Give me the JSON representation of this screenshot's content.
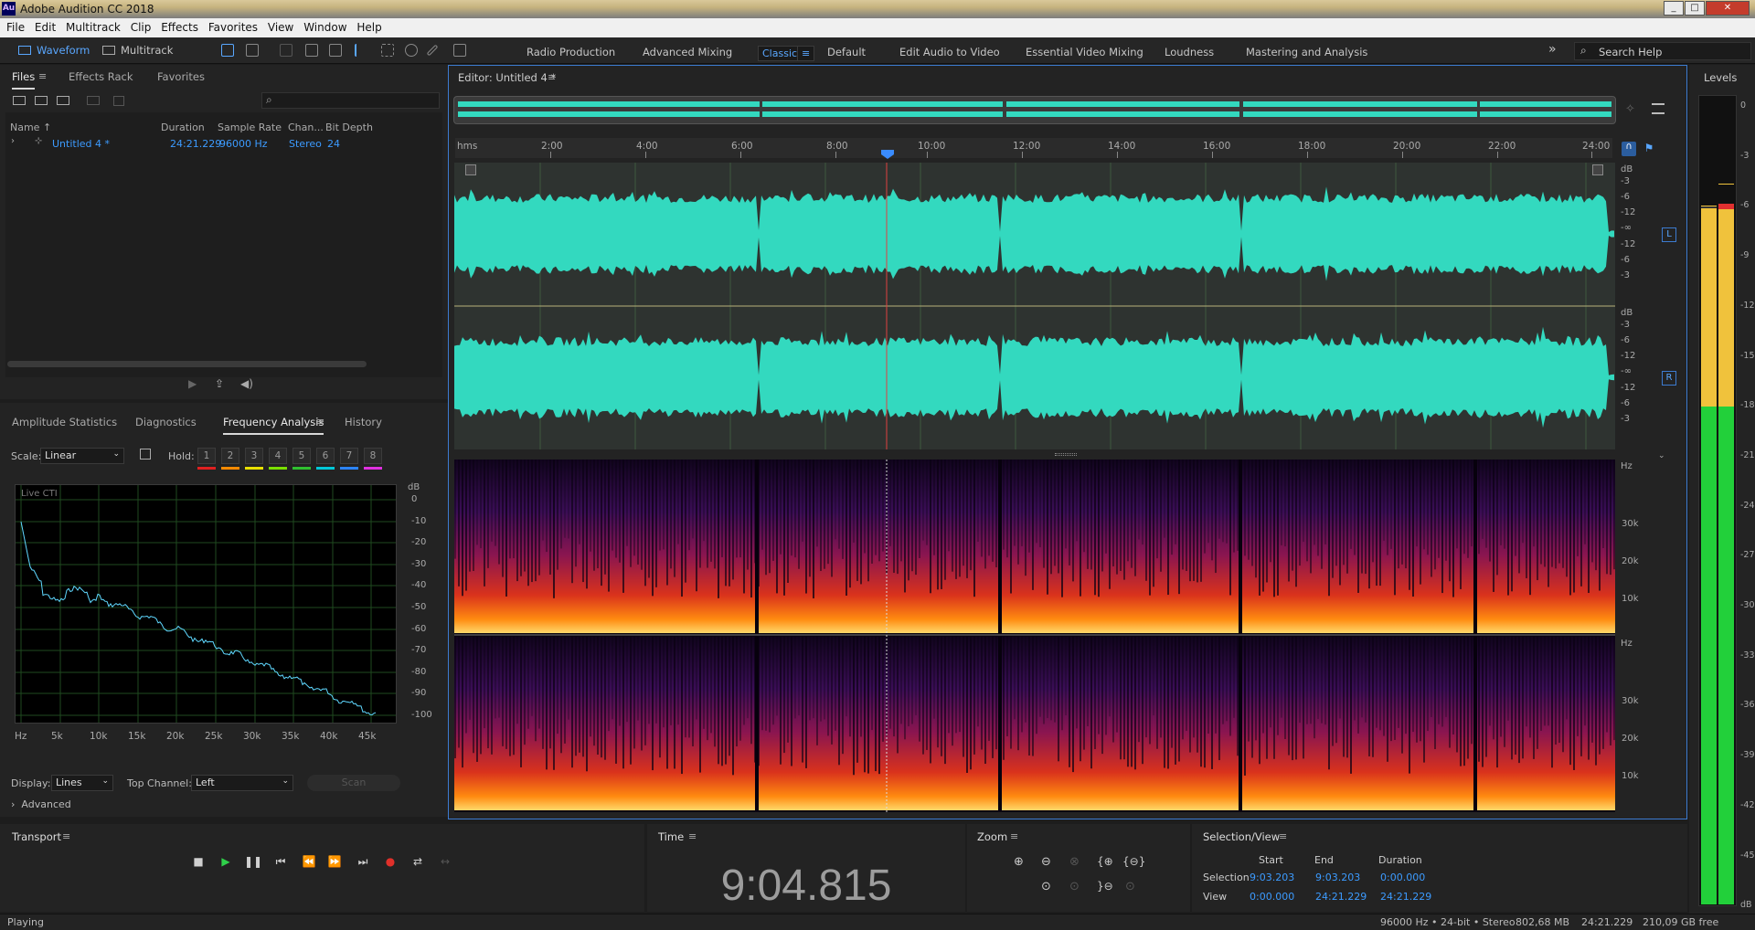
{
  "app": {
    "title": "Adobe Audition CC 2018",
    "logo": "Au"
  },
  "menu": [
    "File",
    "Edit",
    "Multitrack",
    "Clip",
    "Effects",
    "Favorites",
    "View",
    "Window",
    "Help"
  ],
  "toolbar": {
    "waveform": "Waveform",
    "multitrack": "Multitrack",
    "workspaces": [
      "Radio Production",
      "Advanced Mixing",
      "Classic",
      "Default",
      "Edit Audio to Video",
      "Essential Video Mixing",
      "Loudness",
      "Mastering and Analysis"
    ],
    "selected_workspace": "Classic",
    "search_placeholder": "Search Help",
    "overflow_icon": "»"
  },
  "files_panel": {
    "tabs": [
      "Files",
      "Effects Rack",
      "Favorites"
    ],
    "search_icon": "⌕",
    "columns": [
      "Name ↑",
      "Duration",
      "Sample Rate",
      "Chan...",
      "Bit Depth"
    ],
    "rows": [
      {
        "name": "Untitled 4 *",
        "duration": "24:21.229",
        "sample_rate": "96000 Hz",
        "channels": "Stereo",
        "bit_depth": "24"
      }
    ]
  },
  "analysis_panel": {
    "tabs": [
      "Amplitude Statistics",
      "Diagnostics",
      "Frequency Analysis",
      "History"
    ],
    "scale_label": "Scale:",
    "scale_value": "Linear",
    "hold_label": "Hold:",
    "hold_buttons": [
      "1",
      "2",
      "3",
      "4",
      "5",
      "6",
      "7",
      "8"
    ],
    "hold_colors": [
      "#e02020",
      "#ff8a00",
      "#e8e000",
      "#7ae000",
      "#2fc02f",
      "#00c8d8",
      "#2c84ff",
      "#e030e0"
    ],
    "graph_label": "Live CTI",
    "db_label": "dB",
    "db_ticks": [
      "0",
      "-10",
      "-20",
      "-30",
      "-40",
      "-50",
      "-60",
      "-70",
      "-80",
      "-90",
      "-100"
    ],
    "freq_ticks": [
      "Hz",
      "5k",
      "10k",
      "15k",
      "20k",
      "25k",
      "30k",
      "35k",
      "40k",
      "45k"
    ],
    "display_label": "Display:",
    "display_value": "Lines",
    "top_channel_label": "Top Channel:",
    "top_channel_value": "Left",
    "scan_label": "Scan",
    "advanced_label": "Advanced"
  },
  "editor": {
    "title": "Editor: Untitled 4 *",
    "ruler": [
      "hms",
      "2:00",
      "4:00",
      "6:00",
      "8:00",
      "10:00",
      "12:00",
      "14:00",
      "16:00",
      "18:00",
      "20:00",
      "22:00",
      "24:00"
    ],
    "wave_db": [
      "dB",
      "-3",
      "-6",
      "-12",
      "-∞",
      "-12",
      "-6",
      "-3"
    ],
    "channels": [
      "L",
      "R"
    ],
    "spec_unit": "Hz",
    "spec_ticks": [
      "30k",
      "20k",
      "10k"
    ],
    "wave_color": "#33d9bf",
    "playhead_color": "#e04040"
  },
  "levels": {
    "title": "Levels",
    "ticks": [
      "0",
      "-3",
      "-6",
      "-9",
      "-12",
      "-15",
      "-18",
      "-21",
      "-24",
      "-27",
      "-30",
      "-33",
      "-36",
      "-39",
      "-42",
      "-45",
      "dB"
    ]
  },
  "transport": {
    "title": "Transport"
  },
  "time": {
    "title": "Time",
    "value": "9:04.815"
  },
  "zoom": {
    "title": "Zoom"
  },
  "selection_view": {
    "title": "Selection/View",
    "headers": [
      "Start",
      "End",
      "Duration"
    ],
    "selection": {
      "label": "Selection",
      "start": "9:03.203",
      "end": "9:03.203",
      "duration": "0:00.000"
    },
    "view": {
      "label": "View",
      "start": "0:00.000",
      "end": "24:21.229",
      "duration": "24:21.229"
    }
  },
  "status": {
    "left": "Playing",
    "right": [
      "96000 Hz • 24-bit • Stereo",
      "802,68 MB",
      "24:21.229",
      "210,09 GB free"
    ]
  }
}
